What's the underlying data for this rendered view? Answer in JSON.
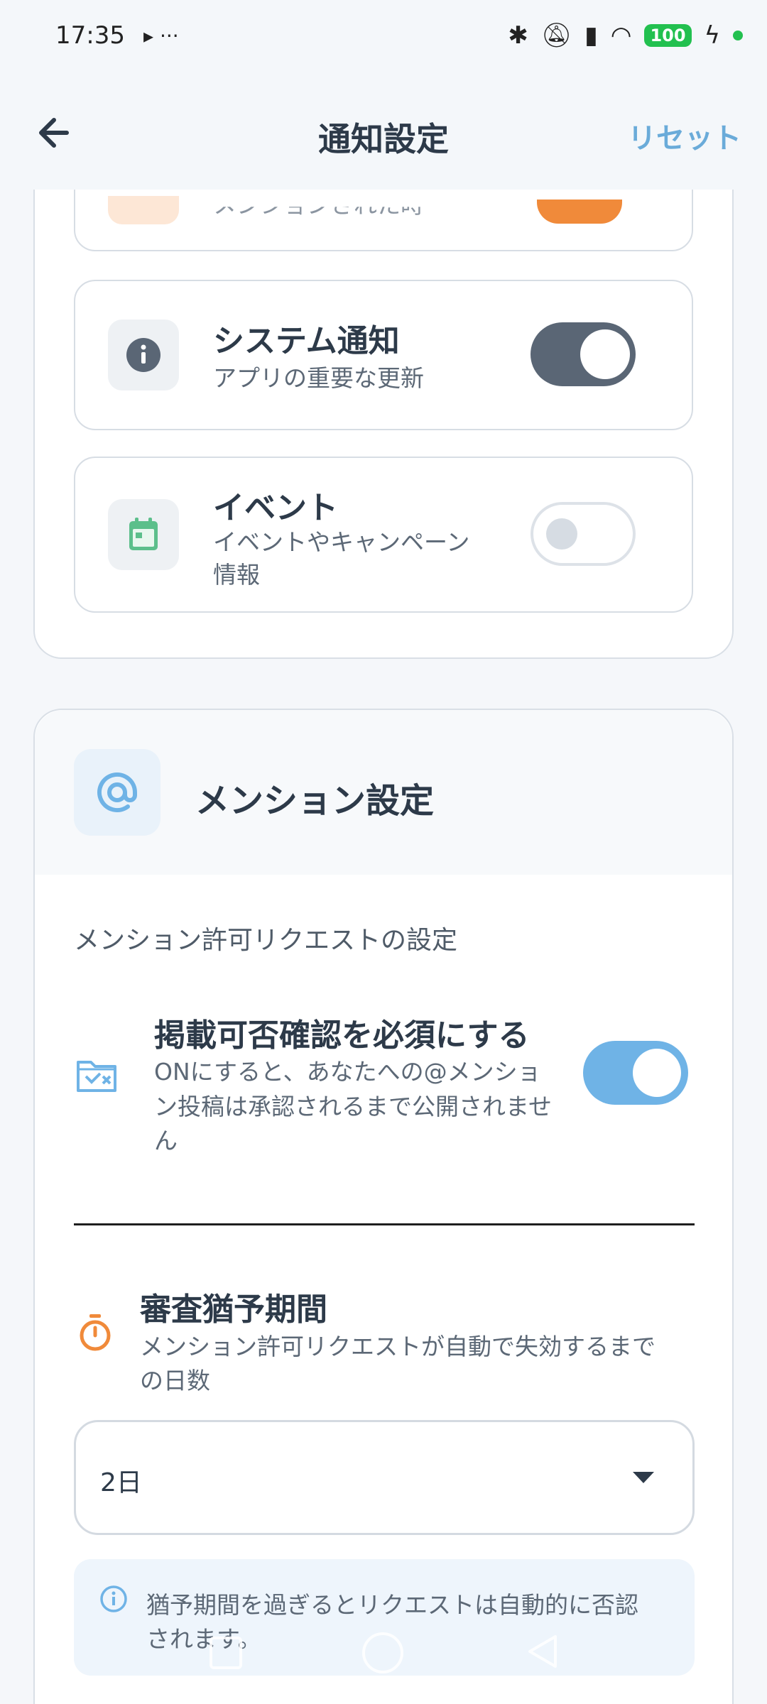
{
  "status_bar": {
    "time": "17:35",
    "extra": "▸ ···",
    "battery": "100"
  },
  "header": {
    "title": "通知設定",
    "reset_label": "リセット"
  },
  "partial_row": {
    "subtitle": "メンションされた時"
  },
  "notifications": [
    {
      "title": "システム通知",
      "subtitle": "アプリの重要な更新",
      "enabled": true,
      "icon": "info-icon",
      "icon_color": "#5a6675"
    },
    {
      "title": "イベント",
      "subtitle": "イベントやキャンペーン情報",
      "subtitle_lines": [
        "イベントやキャンペーン",
        "情報"
      ],
      "enabled": false,
      "icon": "calendar-icon",
      "icon_color": "#5cbf8b"
    }
  ],
  "mention_section": {
    "title": "メンション設定",
    "request_label": "メンション許可リクエストの設定",
    "approval": {
      "title": "掲載可否確認を必須にする",
      "description_lines": [
        "ONにすると、あなたへの@メンショ",
        "ン投稿は承認されるまで公開されませ",
        "ん"
      ],
      "enabled": true
    },
    "grace": {
      "title": "審査猶予期間",
      "description_lines": [
        "メンション許可リクエストが自動で失効するまで",
        "の日数"
      ],
      "selected": "2日"
    },
    "info": {
      "lines": [
        "猶予期間を過ぎるとリクエストは自動的に否認",
        "されます。"
      ]
    }
  },
  "colors": {
    "accent_blue": "#6fb3e6",
    "toggle_dark": "#5a6675",
    "orange": "#f08a3a"
  }
}
